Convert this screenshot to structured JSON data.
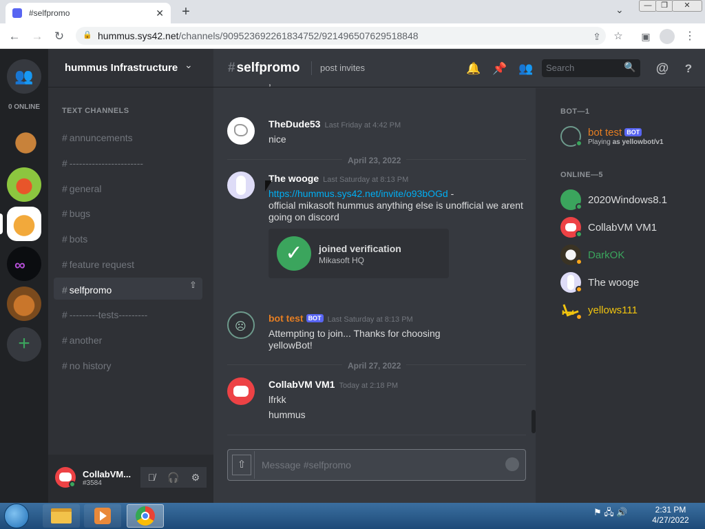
{
  "browser": {
    "tab_title": "#selfpromo",
    "url_host": "hummus.sys42.net",
    "url_path": "/channels/909523692261834752/921496507629518848"
  },
  "server": {
    "name": "hummus Infrastructure",
    "online_label": "0 ONLINE"
  },
  "channels": {
    "category": "TEXT CHANNELS",
    "items": [
      {
        "name": "annuncements",
        "selected": false
      },
      {
        "name": "-----------------------",
        "selected": false
      },
      {
        "name": "general",
        "selected": false
      },
      {
        "name": "bugs",
        "selected": false
      },
      {
        "name": "bots",
        "selected": false
      },
      {
        "name": "feature request",
        "selected": false
      },
      {
        "name": "selfpromo",
        "selected": true
      },
      {
        "name": "---------tests---------",
        "selected": false
      },
      {
        "name": "another",
        "selected": false
      },
      {
        "name": "no history",
        "selected": false
      }
    ]
  },
  "user_panel": {
    "name": "CollabVM...",
    "tag": "#3584"
  },
  "header": {
    "channel": "selfpromo",
    "topic": "post invites",
    "search_placeholder": "Search"
  },
  "messages": {
    "m1": {
      "author": "TheDude53",
      "timestamp": "Last Friday at 4:42 PM",
      "text": "nice"
    },
    "d1": "April 23, 2022",
    "m2": {
      "author": "The wooge",
      "timestamp": "Last Saturday at 8:13 PM",
      "link": "https://hummus.sys42.net/invite/o93bOGd",
      "link_suffix": " -",
      "text": "official mikasoft hummus anything else is unofficial we arent going on discord",
      "embed_title": "joined verification",
      "embed_sub": "Mikasoft HQ"
    },
    "m3": {
      "author": "bot test",
      "badge": "BOT",
      "timestamp": "Last Saturday at 8:13 PM",
      "text": "Attempting to join... Thanks for choosing yellowBot!"
    },
    "d2": "April 27, 2022",
    "m4": {
      "author": "CollabVM VM1",
      "timestamp": "Today at 2:18 PM",
      "line1": "lfrkk",
      "line2": "hummus"
    }
  },
  "composer": {
    "placeholder": "Message #selfpromo"
  },
  "members": {
    "bot_cat": "BOT—1",
    "bot": {
      "name": "bot test",
      "badge": "BOT",
      "activity_prefix": "Playing",
      "activity": "as yellowbot/v1"
    },
    "online_cat": "ONLINE—5",
    "online": [
      {
        "name": "2020Windows8.1",
        "color": "#dcddde"
      },
      {
        "name": "CollabVM VM1",
        "color": "#dcddde"
      },
      {
        "name": "DarkOK",
        "color": "#3ba55d"
      },
      {
        "name": "The wooge",
        "color": "#dcddde"
      },
      {
        "name": "yellows111",
        "color": "#f1c40f"
      }
    ]
  },
  "taskbar": {
    "time": "2:31 PM",
    "date": "4/27/2022"
  },
  "colors": {
    "blurple": "#5865f2",
    "green": "#3ba55d",
    "red": "#ed4245",
    "bot_orange": "#e67e22",
    "link": "#00aff4"
  }
}
